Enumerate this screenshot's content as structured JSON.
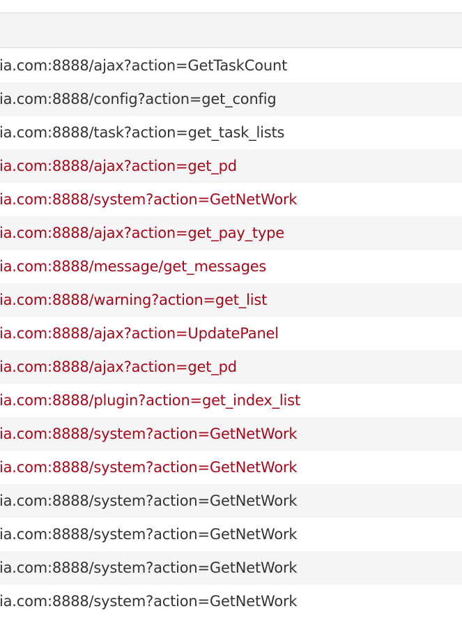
{
  "colors": {
    "normal_text": "#333333",
    "failed_text": "#a8071a",
    "stripe": "#f5f5f5",
    "header_bg": "#f3f3f3"
  },
  "requests": [
    {
      "url": "ia.com:8888/ajax?action=GetTaskCount",
      "status": "ok"
    },
    {
      "url": "ia.com:8888/config?action=get_config",
      "status": "ok"
    },
    {
      "url": "ia.com:8888/task?action=get_task_lists",
      "status": "ok"
    },
    {
      "url": "ia.com:8888/ajax?action=get_pd",
      "status": "failed"
    },
    {
      "url": "ia.com:8888/system?action=GetNetWork",
      "status": "failed"
    },
    {
      "url": "ia.com:8888/ajax?action=get_pay_type",
      "status": "failed"
    },
    {
      "url": "ia.com:8888/message/get_messages",
      "status": "failed"
    },
    {
      "url": "ia.com:8888/warning?action=get_list",
      "status": "failed"
    },
    {
      "url": "ia.com:8888/ajax?action=UpdatePanel",
      "status": "failed"
    },
    {
      "url": "ia.com:8888/ajax?action=get_pd",
      "status": "failed"
    },
    {
      "url": "ia.com:8888/plugin?action=get_index_list",
      "status": "failed"
    },
    {
      "url": "ia.com:8888/system?action=GetNetWork",
      "status": "failed"
    },
    {
      "url": "ia.com:8888/system?action=GetNetWork",
      "status": "failed"
    },
    {
      "url": "ia.com:8888/system?action=GetNetWork",
      "status": "ok"
    },
    {
      "url": "ia.com:8888/system?action=GetNetWork",
      "status": "ok"
    },
    {
      "url": "ia.com:8888/system?action=GetNetWork",
      "status": "ok"
    },
    {
      "url": "ia.com:8888/system?action=GetNetWork",
      "status": "ok"
    }
  ]
}
